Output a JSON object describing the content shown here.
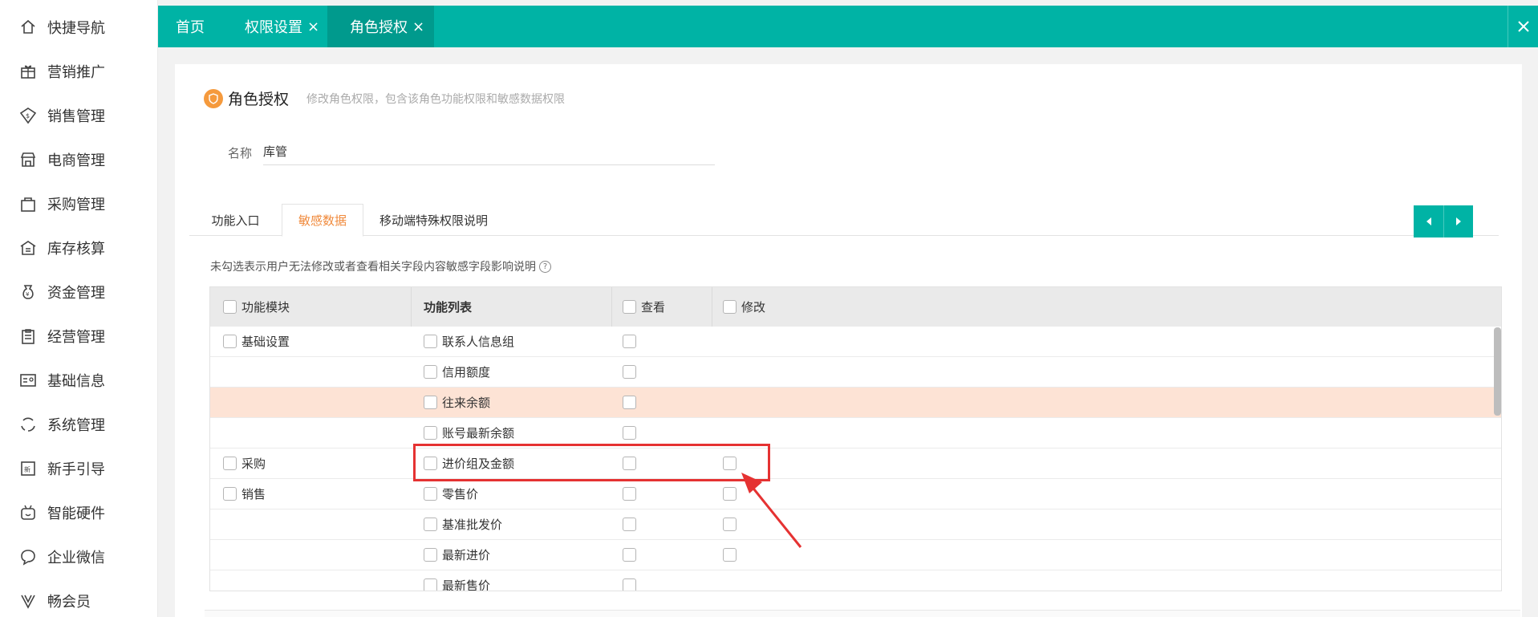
{
  "sidebar": {
    "items": [
      {
        "label": "快捷导航",
        "icon": "home-icon"
      },
      {
        "label": "营销推广",
        "icon": "gift-icon"
      },
      {
        "label": "销售管理",
        "icon": "sales-icon"
      },
      {
        "label": "电商管理",
        "icon": "store-icon"
      },
      {
        "label": "采购管理",
        "icon": "bag-icon"
      },
      {
        "label": "库存核算",
        "icon": "warehouse-icon"
      },
      {
        "label": "资金管理",
        "icon": "money-bag-icon"
      },
      {
        "label": "经营管理",
        "icon": "clipboard-icon"
      },
      {
        "label": "基础信息",
        "icon": "id-card-icon"
      },
      {
        "label": "系统管理",
        "icon": "cycle-icon"
      },
      {
        "label": "新手引导",
        "icon": "new-badge-icon"
      },
      {
        "label": "智能硬件",
        "icon": "device-icon"
      },
      {
        "label": "企业微信",
        "icon": "chat-icon"
      },
      {
        "label": "畅会员",
        "icon": "v-icon"
      }
    ]
  },
  "tabbar": {
    "tabs": [
      {
        "label": "首页",
        "closable": false,
        "active": false
      },
      {
        "label": "权限设置",
        "closable": true,
        "active": false
      },
      {
        "label": "角色授权",
        "closable": true,
        "active": true
      }
    ],
    "close_glyph": "×"
  },
  "page": {
    "title": "角色授权",
    "subtitle": "修改角色权限，包含该角色功能权限和敏感数据权限",
    "name_label": "名称",
    "name_value": "库管",
    "subtabs": [
      "功能入口",
      "敏感数据",
      "移动端特殊权限说明"
    ],
    "active_subtab": "敏感数据",
    "hint": "未勾选表示用户无法修改或者查看相关字段内容敏感字段影响说明",
    "help_glyph": "?"
  },
  "table": {
    "columns": {
      "module": "功能模块",
      "list": "功能列表",
      "view": "查看",
      "edit": "修改"
    },
    "rows": [
      {
        "module": "基础设置",
        "item": "联系人信息组",
        "has_edit": false,
        "highlight": false
      },
      {
        "module": "",
        "item": "信用额度",
        "has_edit": false,
        "highlight": false
      },
      {
        "module": "",
        "item": "往来余额",
        "has_edit": false,
        "highlight": true
      },
      {
        "module": "",
        "item": "账号最新余额",
        "has_edit": false,
        "highlight": false
      },
      {
        "module": "采购",
        "item": "进价组及金额",
        "has_edit": true,
        "highlight": false
      },
      {
        "module": "销售",
        "item": "零售价",
        "has_edit": true,
        "highlight": false
      },
      {
        "module": "",
        "item": "基准批发价",
        "has_edit": true,
        "highlight": false
      },
      {
        "module": "",
        "item": "最新进价",
        "has_edit": true,
        "highlight": false
      },
      {
        "module": "",
        "item": "最新售价",
        "has_edit": false,
        "highlight": false
      }
    ]
  },
  "colors": {
    "accent": "#00b3a5",
    "accent_dark": "#009a8d",
    "orange": "#f08a3c",
    "highlight_row": "#fde3d5",
    "annotation_red": "#e53232"
  }
}
